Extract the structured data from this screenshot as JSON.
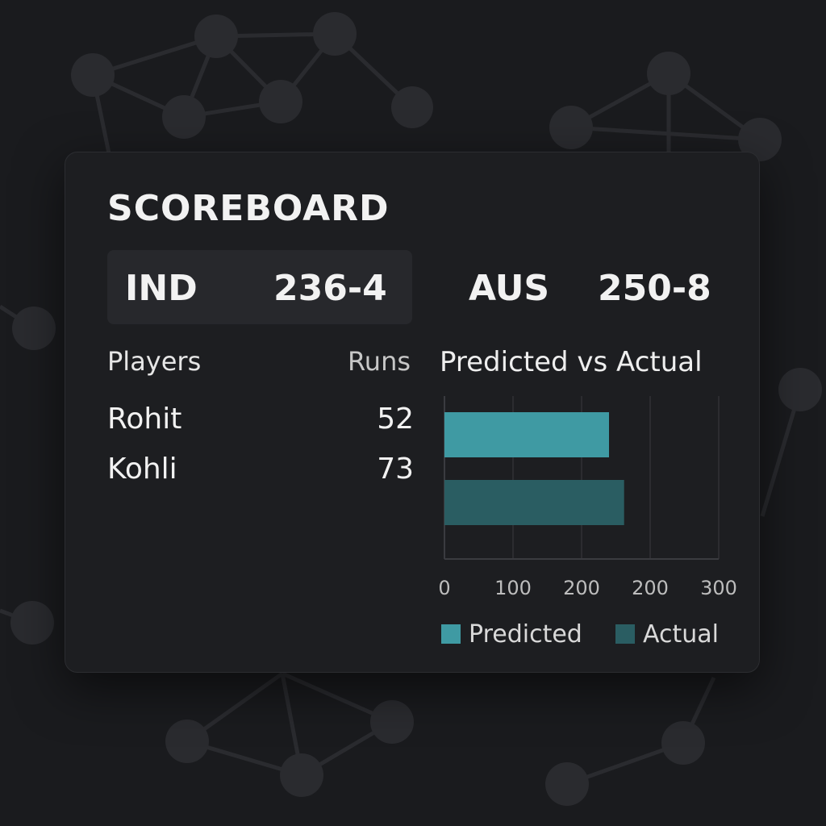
{
  "scoreboard": {
    "title": "SCOREBOARD",
    "team1": {
      "name": "IND",
      "score": "236-4"
    },
    "team2": {
      "name": "AUS",
      "score": "250-8"
    }
  },
  "players_table": {
    "headers": {
      "players": "Players",
      "runs": "Runs"
    },
    "rows": [
      {
        "name": "Rohit",
        "runs": "52"
      },
      {
        "name": "Kohli",
        "runs": "73"
      }
    ]
  },
  "colors": {
    "background": "#1a1b1e",
    "card": "#1d1e21",
    "predicted": "#3f9aa3",
    "actual": "#2a5d62",
    "grid": "#3a3b40"
  },
  "chart_data": {
    "type": "bar",
    "orientation": "horizontal",
    "title": "Predicted vs Actual",
    "categories": [
      "Predicted",
      "Actual"
    ],
    "series": [
      {
        "name": "Predicted",
        "values": [
          240
        ]
      },
      {
        "name": "Actual",
        "values": [
          262
        ]
      }
    ],
    "xlim": [
      0,
      400
    ],
    "tick_labels": [
      "0",
      "100",
      "200",
      "200",
      "300"
    ],
    "grid": true,
    "legend": "bottom",
    "legend_entries": [
      "Predicted",
      "Actual"
    ]
  }
}
